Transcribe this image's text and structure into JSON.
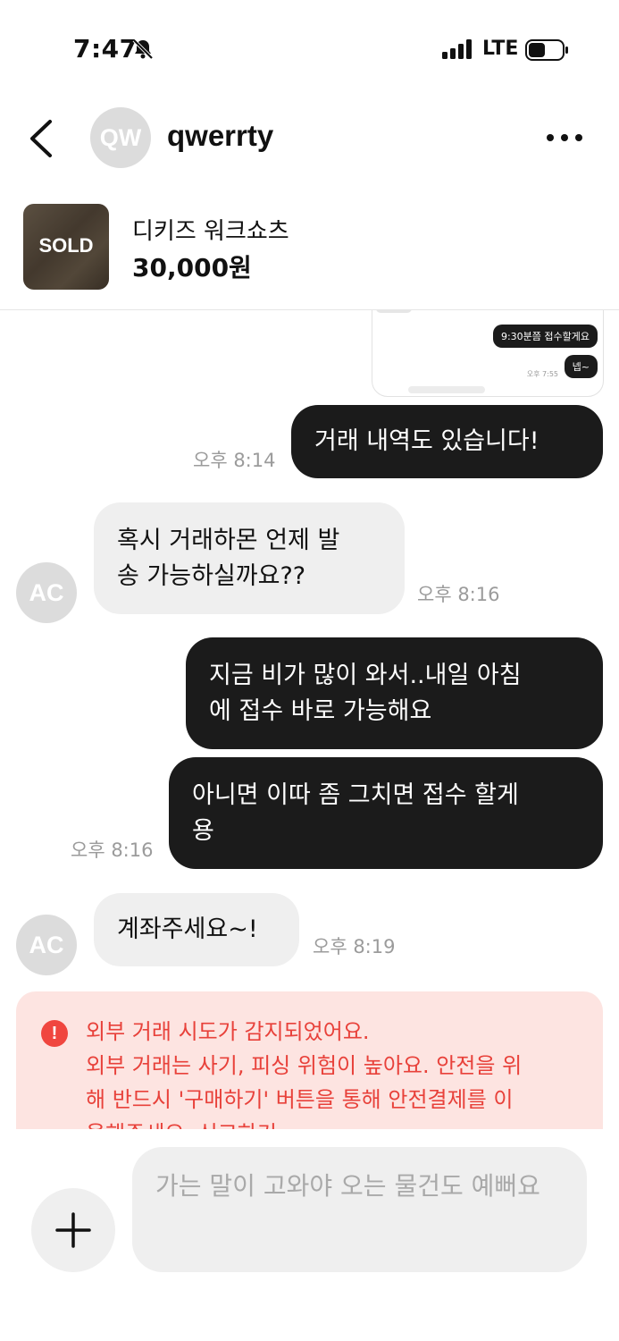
{
  "status_bar": {
    "time": "7:47",
    "network": "LTE"
  },
  "header": {
    "avatar_initials": "QW",
    "username": "qwerrty",
    "back_icon": "chevron-left-icon",
    "more_icon": "more-horizontal-icon"
  },
  "product": {
    "badge": "SOLD",
    "title": "디키즈 워크쇼츠",
    "price": "30,000원"
  },
  "screenshot_preview": {
    "bubble1": "9:30분쯤 접수할게요",
    "bubble2": "넵~",
    "time": "오후 7:55"
  },
  "messages": [
    {
      "side": "out",
      "lines": [
        "거래 내역도 있습니다!"
      ],
      "time": "오후 8:14"
    },
    {
      "side": "in",
      "avatar": "AC",
      "lines": [
        "혹시 거래하몬 언제 발",
        "송 가능하실까요??"
      ],
      "time": "오후 8:16"
    },
    {
      "side": "out",
      "lines": [
        "지금 비가 많이 와서..내일 아침",
        "에 접수 바로 가능해요"
      ],
      "time": ""
    },
    {
      "side": "out",
      "lines": [
        "아니면 이따 좀 그치면 접수 할게",
        "용"
      ],
      "time": "오후 8:16"
    },
    {
      "side": "in",
      "avatar": "AC",
      "lines": [
        "계좌주세요~!"
      ],
      "time": "오후 8:19"
    }
  ],
  "warning": {
    "icon": "!",
    "line1": "외부 거래 시도가 감지되었어요.",
    "line2": "외부 거래는 사기, 피싱 위험이 높아요. 안전을 위",
    "line3": "해 반드시 '구매하기' 버튼을 통해 안전결제를 이",
    "line4": "용해주세요. 신고하기"
  },
  "input": {
    "placeholder": "가는 말이 고와야 오는 물건도 예뻐요"
  },
  "colors": {
    "bubble_out": "#1b1b1b",
    "bubble_in": "#efefef",
    "warning_bg": "#fde4e1",
    "warning_text": "#e8413a"
  }
}
